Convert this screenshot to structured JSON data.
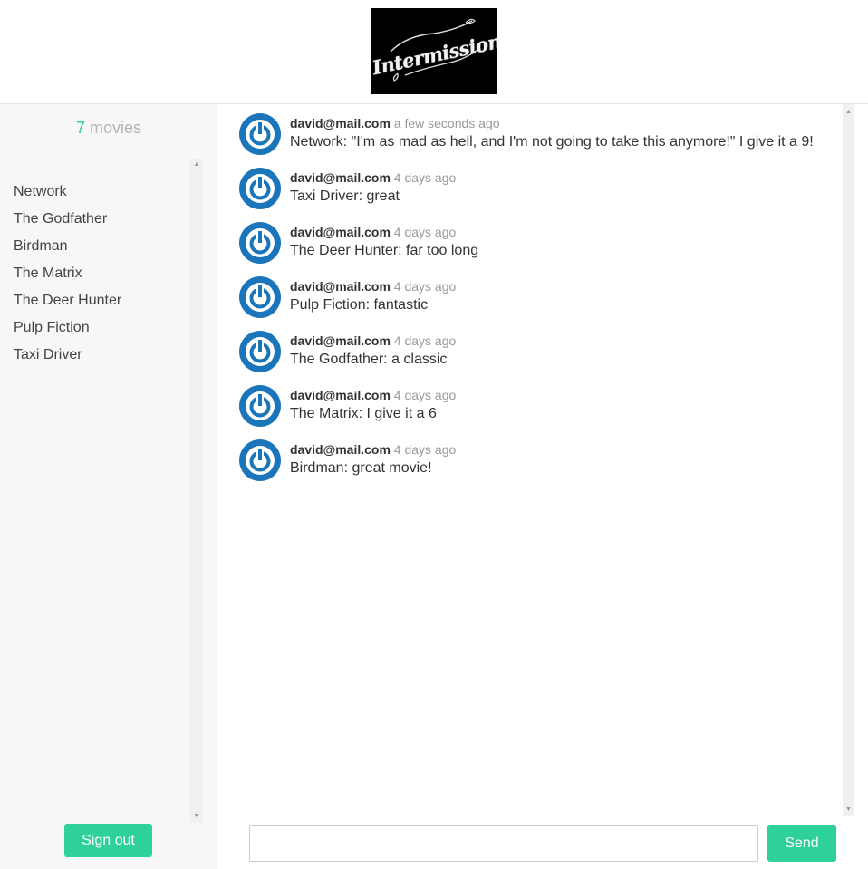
{
  "header": {
    "logo_text": "Intermission"
  },
  "sidebar": {
    "count": "7",
    "count_label": " movies",
    "movies": [
      "Network",
      "The Godfather",
      "Birdman",
      "The Matrix",
      "The Deer Hunter",
      "Pulp Fiction",
      "Taxi Driver"
    ],
    "signout_label": "Sign out"
  },
  "messages": [
    {
      "author": "david@mail.com",
      "time": "a few seconds ago",
      "text": "Network: \"I'm as mad as hell, and I'm not going to take this anymore!\" I give it a 9!"
    },
    {
      "author": "david@mail.com",
      "time": "4 days ago",
      "text": "Taxi Driver: great"
    },
    {
      "author": "david@mail.com",
      "time": "4 days ago",
      "text": "The Deer Hunter: far too long"
    },
    {
      "author": "david@mail.com",
      "time": "4 days ago",
      "text": "Pulp Fiction: fantastic"
    },
    {
      "author": "david@mail.com",
      "time": "4 days ago",
      "text": "The Godfather: a classic"
    },
    {
      "author": "david@mail.com",
      "time": "4 days ago",
      "text": "The Matrix: I give it a 6"
    },
    {
      "author": "david@mail.com",
      "time": "4 days ago",
      "text": "Birdman: great movie!"
    }
  ],
  "composer": {
    "value": "",
    "send_label": "Send"
  },
  "colors": {
    "accent": "#2ed19b",
    "avatar_blue": "#1a75bb"
  },
  "icons": {
    "avatar": "power-icon",
    "scroll_up": "arrow-up-icon",
    "scroll_down": "arrow-down-icon"
  }
}
